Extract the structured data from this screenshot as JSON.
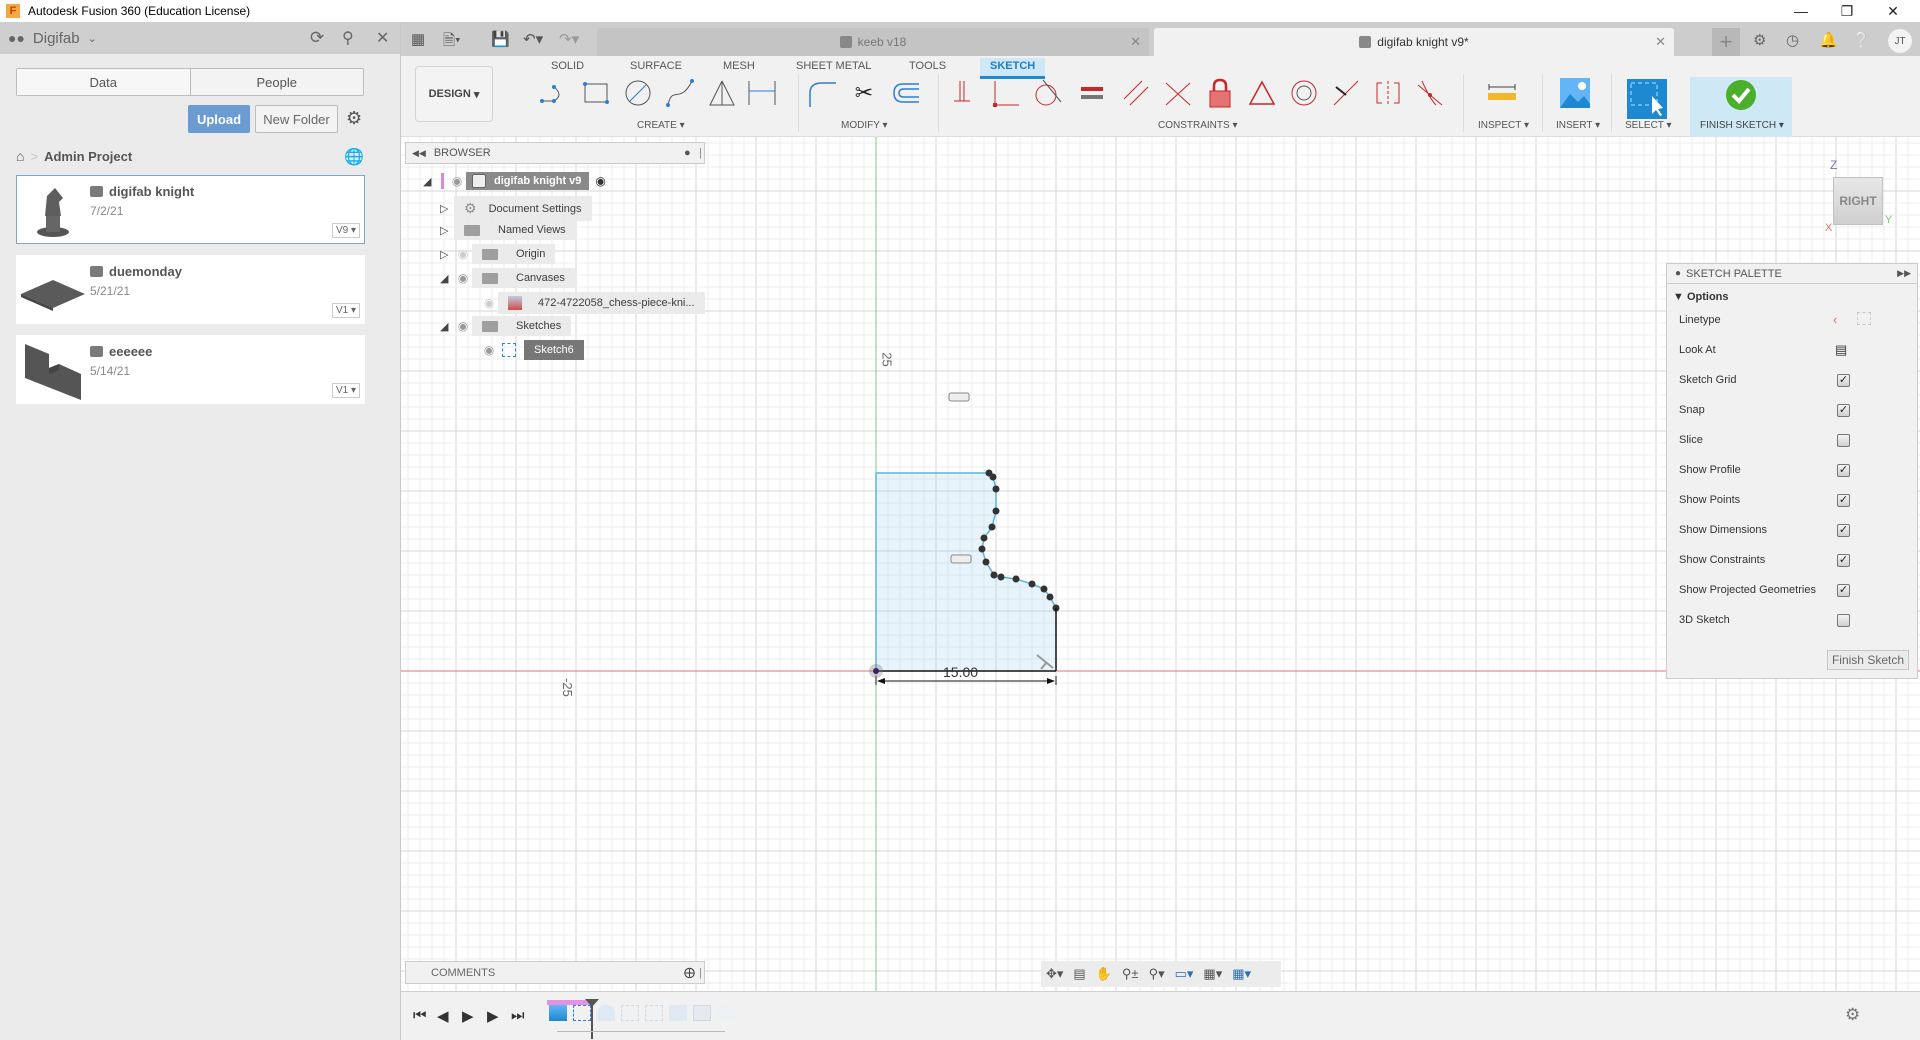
{
  "window": {
    "title": "Autodesk Fusion 360 (Education License)",
    "app_icon": "F"
  },
  "data_panel": {
    "team": "Digifab",
    "tabs": [
      "Data",
      "People"
    ],
    "upload_label": "Upload",
    "new_folder_label": "New Folder",
    "breadcrumb": "Admin Project",
    "items": [
      {
        "name": "digifab knight",
        "date": "7/2/21",
        "version": "V9",
        "selected": true
      },
      {
        "name": "duemonday",
        "date": "5/21/21",
        "version": "V1",
        "selected": false
      },
      {
        "name": "eeeeee",
        "date": "5/14/21",
        "version": "V1",
        "selected": false
      }
    ]
  },
  "doc_tabs": [
    {
      "label": "keeb v18",
      "active": false
    },
    {
      "label": "digifab knight v9*",
      "active": true
    }
  ],
  "user_initials": "JT",
  "toolbar": {
    "workspace": "DESIGN",
    "tabs": [
      "SOLID",
      "SURFACE",
      "MESH",
      "SHEET METAL",
      "TOOLS",
      "SKETCH"
    ],
    "active_tab": "SKETCH",
    "groups": {
      "create": "CREATE",
      "modify": "MODIFY",
      "constraints": "CONSTRAINTS",
      "inspect": "INSPECT",
      "insert": "INSERT",
      "select": "SELECT",
      "finish": "FINISH SKETCH"
    }
  },
  "browser": {
    "title": "BROWSER",
    "root": "digifab knight v9",
    "nodes": [
      {
        "label": "Document Settings",
        "icon": "gear-icon"
      },
      {
        "label": "Named Views",
        "icon": "folder-icon"
      },
      {
        "label": "Origin",
        "icon": "folder-icon"
      },
      {
        "label": "Canvases",
        "icon": "folder-icon"
      },
      {
        "label": "472-4722058_chess-piece-kni...",
        "icon": "image-icon"
      },
      {
        "label": "Sketches",
        "icon": "folder-icon"
      },
      {
        "label": "Sketch6",
        "icon": "sketch-icon"
      }
    ]
  },
  "canvas": {
    "axis_label_top": "25",
    "axis_label_left": "-25",
    "dimension": "15.00",
    "viewcube": "RIGHT",
    "axes": {
      "x": "X",
      "y": "Y",
      "z": "Z"
    }
  },
  "sketch_palette": {
    "title": "SKETCH PALETTE",
    "section": "Options",
    "rows": [
      {
        "label": "Linetype",
        "type": "icons"
      },
      {
        "label": "Look At",
        "type": "icon"
      },
      {
        "label": "Sketch Grid",
        "checked": true
      },
      {
        "label": "Snap",
        "checked": true
      },
      {
        "label": "Slice",
        "checked": false
      },
      {
        "label": "Show Profile",
        "checked": true
      },
      {
        "label": "Show Points",
        "checked": true
      },
      {
        "label": "Show Dimensions",
        "checked": true
      },
      {
        "label": "Show Constraints",
        "checked": true
      },
      {
        "label": "Show Projected Geometries",
        "checked": true
      },
      {
        "label": "3D Sketch",
        "checked": false
      }
    ],
    "finish_label": "Finish Sketch"
  },
  "comments": {
    "title": "COMMENTS"
  },
  "colors": {
    "accent": "#1e88d0",
    "upload": "#6a9bd1",
    "finish_green": "#4caf2c",
    "x_axis": "#e57373",
    "y_axis": "#81c784"
  }
}
